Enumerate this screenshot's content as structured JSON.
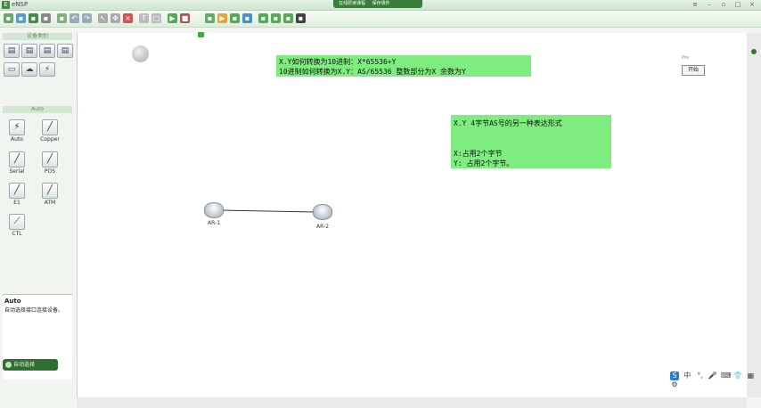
{
  "window": {
    "title": "eNSP",
    "notice_button_1": "在线研读课程",
    "notice_button_2": "保存课件"
  },
  "toolbar": {
    "buttons": [
      "new-icon",
      "open-icon",
      "save-icon",
      "save-as-icon",
      "print-icon",
      "undo-icon",
      "redo-icon",
      "select-icon",
      "move-icon",
      "delete-icon",
      "text-icon",
      "rect-icon",
      "start-icon",
      "stop-icon",
      "capture-icon",
      "console-icon",
      "topo-icon",
      "setting-icon",
      "help-icon"
    ]
  },
  "left_panel": {
    "device_header": "设备类别",
    "cable_header": "Auto",
    "cables": [
      {
        "label": "Auto",
        "icon": "lightning-icon"
      },
      {
        "label": "Copper",
        "icon": "copper-cable-icon"
      },
      {
        "label": "Serial",
        "icon": "serial-cable-icon"
      },
      {
        "label": "POS",
        "icon": "pos-cable-icon"
      },
      {
        "label": "E1",
        "icon": "e1-cable-icon"
      },
      {
        "label": "ATM",
        "icon": "atm-cable-icon"
      },
      {
        "label": "CTL",
        "icon": "ctl-cable-icon"
      }
    ],
    "info_title": "Auto",
    "info_desc": "自动选择接口连接设备。",
    "bottom_button": "自动选择"
  },
  "canvas": {
    "note1": {
      "line1": "X.Y如何转换为10进制：X*65536+Y",
      "line2": "10进制如何转换为X.Y：AS/65536   整数部分为X  余数为Y"
    },
    "note2": {
      "line1": "X.Y    4字节AS号的另一种表达形式",
      "line2": "X:占用2个字节",
      "line3": "Y: 占用2个字节。"
    },
    "routers": [
      {
        "label": "AR-1"
      },
      {
        "label": "AR-2"
      }
    ],
    "side_widget_label": "Pre",
    "side_widget_button": "开始"
  },
  "tray": [
    "S",
    "中",
    "°,",
    "🎤",
    "⌨",
    "👕",
    "▦",
    "⚙"
  ],
  "colors": {
    "note_bg": "#7fec7f",
    "accent": "#2e7d32"
  }
}
